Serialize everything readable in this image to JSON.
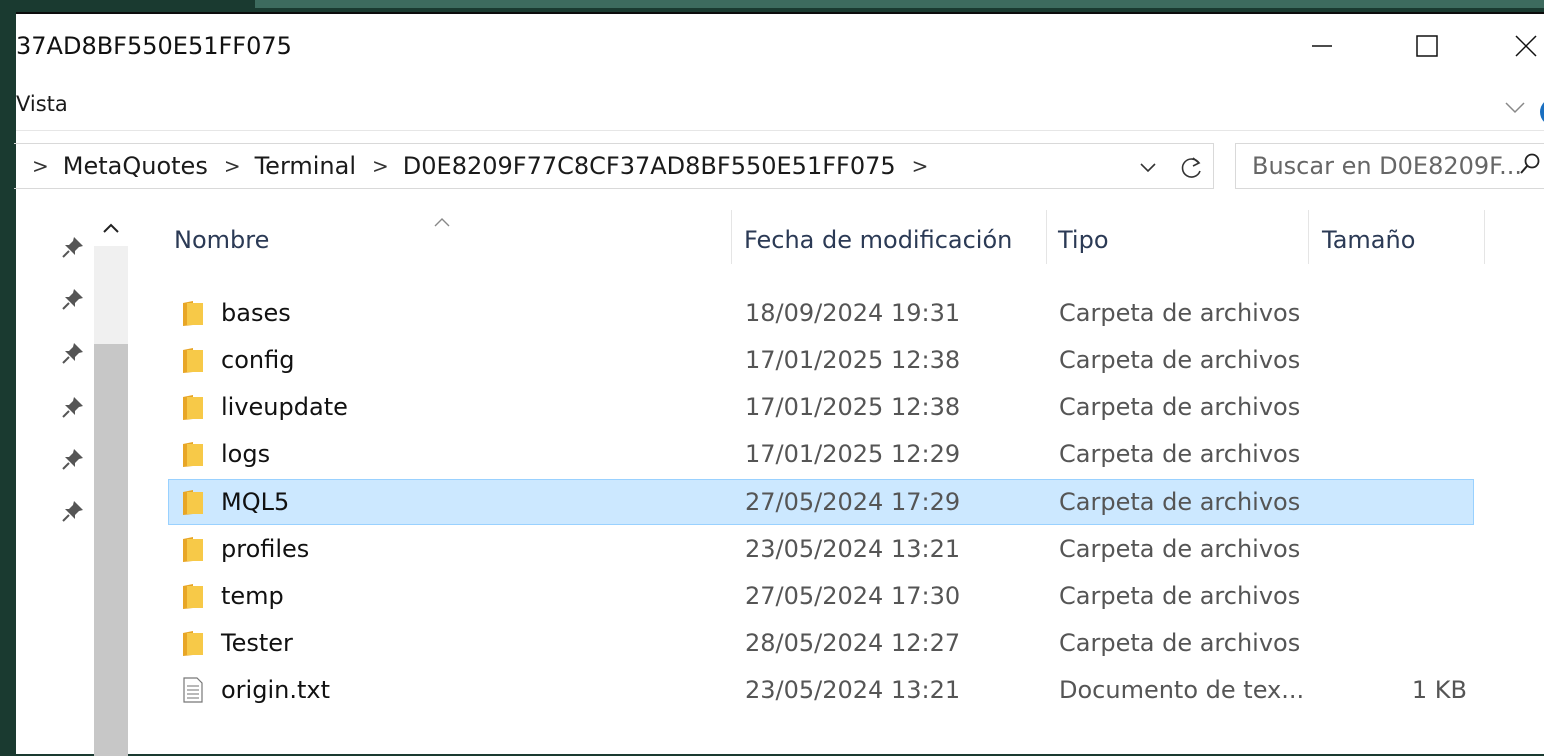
{
  "window": {
    "title": "37AD8BF550E51FF075",
    "controls": {
      "minimize": "minimize-icon",
      "maximize": "maximize-icon",
      "close": "close-icon"
    }
  },
  "ribbon": {
    "tab_vista": "Vista"
  },
  "address": {
    "breadcrumbs": [
      "MetaQuotes",
      "Terminal",
      "D0E8209F77C8CF37AD8BF550E51FF075"
    ]
  },
  "search": {
    "placeholder": "Buscar en D0E8209F..."
  },
  "columns": {
    "name": "Nombre",
    "date": "Fecha de modificación",
    "type": "Tipo",
    "size": "Tamaño"
  },
  "files": [
    {
      "name": "bases",
      "date": "18/09/2024 19:31",
      "type": "Carpeta de archivos",
      "size": "",
      "icon": "folder-icon",
      "selected": false
    },
    {
      "name": "config",
      "date": "17/01/2025 12:38",
      "type": "Carpeta de archivos",
      "size": "",
      "icon": "folder-icon",
      "selected": false
    },
    {
      "name": "liveupdate",
      "date": "17/01/2025 12:38",
      "type": "Carpeta de archivos",
      "size": "",
      "icon": "folder-icon",
      "selected": false
    },
    {
      "name": "logs",
      "date": "17/01/2025 12:29",
      "type": "Carpeta de archivos",
      "size": "",
      "icon": "folder-icon",
      "selected": false
    },
    {
      "name": "MQL5",
      "date": "27/05/2024 17:29",
      "type": "Carpeta de archivos",
      "size": "",
      "icon": "folder-icon",
      "selected": true
    },
    {
      "name": "profiles",
      "date": "23/05/2024 13:21",
      "type": "Carpeta de archivos",
      "size": "",
      "icon": "folder-icon",
      "selected": false
    },
    {
      "name": "temp",
      "date": "27/05/2024 17:30",
      "type": "Carpeta de archivos",
      "size": "",
      "icon": "folder-icon",
      "selected": false
    },
    {
      "name": "Tester",
      "date": "28/05/2024 12:27",
      "type": "Carpeta de archivos",
      "size": "",
      "icon": "folder-icon",
      "selected": false
    },
    {
      "name": "origin.txt",
      "date": "23/05/2024 13:21",
      "type": "Documento de tex...",
      "size": "1 KB",
      "icon": "text-file-icon",
      "selected": false
    }
  ],
  "colors": {
    "selection_bg": "#cce8ff",
    "selection_border": "#99d1ff",
    "folder": "#f7c948",
    "desktop": "#1a3a30"
  }
}
